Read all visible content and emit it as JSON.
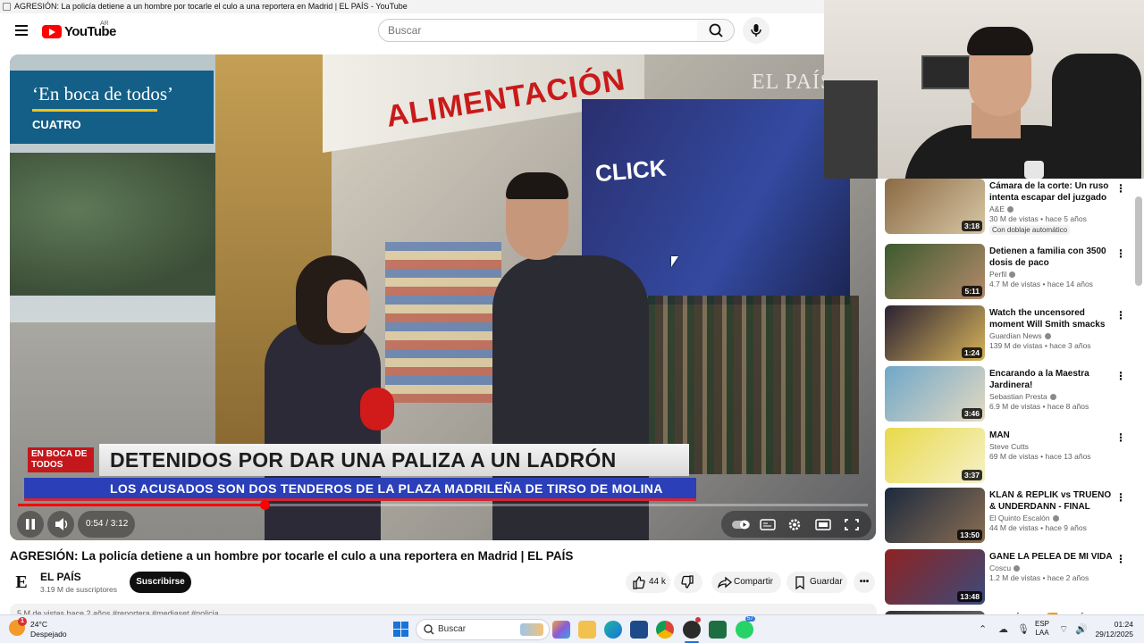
{
  "window": {
    "title": "AGRESIÓN: La policía detiene a un hombre por tocarle el culo a una reportera en Madrid | EL PAÍS - YouTube"
  },
  "masthead": {
    "logo_text": "YouTube",
    "country_code": "AR",
    "search_placeholder": "Buscar",
    "icons": [
      "menu-icon",
      "search-icon",
      "mic-icon"
    ]
  },
  "player": {
    "overlay": {
      "watermark": "EL PAÍS",
      "program_title": "‘En boca de todos’",
      "program_channel": "CUATRO",
      "shop_sign": "ALIMENTACIÓN",
      "poster_text": "CLICK",
      "chyron_badge": "EN BOCA DE TODOS",
      "chyron_headline": "DETENIDOS POR DAR UNA PALIZA A UN LADRÓN",
      "chyron_sub": "LOS ACUSADOS SON DOS TENDEROS DE LA PLAZA MADRILEÑA DE TIRSO DE MOLINA"
    },
    "time": "0:54 / 3:12",
    "progress_fraction": 0.29,
    "accent_color": "#ff0000"
  },
  "video": {
    "title": "AGRESIÓN: La policía detiene a un hombre por tocarle el culo a una reportera en Madrid | EL PAÍS",
    "channel_logo": "E",
    "channel_name": "EL PAÍS",
    "subscribers": "3.19 M de suscriptores",
    "subscribe_label": "Suscribirse",
    "likes": "44 k",
    "share_label": "Compartir",
    "save_label": "Guardar",
    "description_preview": "5 M de vistas  hace 2 años  #reportera #mediaset #policia"
  },
  "recommendations": [
    {
      "title": "Cámara de la corte: Un ruso intenta escapar del juzgado ...",
      "channel": "A&E",
      "verified": true,
      "views": "30 M de vistas",
      "age": "hace 5 años",
      "duration": "3:18",
      "badge": "Con doblaje automático"
    },
    {
      "title": "Detienen a familia con 3500 dosis de paco",
      "channel": "Perfil",
      "verified": true,
      "views": "4.7 M de vistas",
      "age": "hace 14 años",
      "duration": "5:11"
    },
    {
      "title": "Watch the uncensored moment Will Smith smacks Chris Rock ...",
      "channel": "Guardian News",
      "verified": true,
      "views": "139 M de vistas",
      "age": "hace 3 años",
      "duration": "1:24"
    },
    {
      "title": "Encarando a la Maestra Jardinera!",
      "channel": "Sebastian Presta",
      "verified": true,
      "views": "6.9 M de vistas",
      "age": "hace 8 años",
      "duration": "3:46"
    },
    {
      "title": "MAN",
      "channel": "Steve Cutts",
      "verified": false,
      "views": "69 M de vistas",
      "age": "hace 13 años",
      "duration": "3:37"
    },
    {
      "title": "KLAN & REPLIK vs TRUENO & UNDERDANN - FINAL (2VS1 - ...",
      "channel": "El Quinto Escalón",
      "verified": true,
      "views": "44 M de vistas",
      "age": "hace 9 años",
      "duration": "13:50"
    },
    {
      "title": "GANE LA PELEA DE MI VIDA",
      "channel": "Coscu",
      "verified": true,
      "views": "1.2 M de vistas",
      "age": "hace 2 años",
      "duration": "13:48"
    },
    {
      "title": "¿GERÓNIMO 🟧 ANTÚNEZ!",
      "channel": "",
      "verified": false,
      "views": "",
      "age": "",
      "duration": ""
    }
  ],
  "taskbar": {
    "weather_temp": "24°C",
    "weather_desc": "Despejado",
    "weather_alert": "1",
    "search_label": "Buscar",
    "whatsapp_count": "57",
    "lang_top": "ESP",
    "lang_bottom": "LAA",
    "clock_time": "01:24",
    "clock_date": "29/12/2025"
  }
}
